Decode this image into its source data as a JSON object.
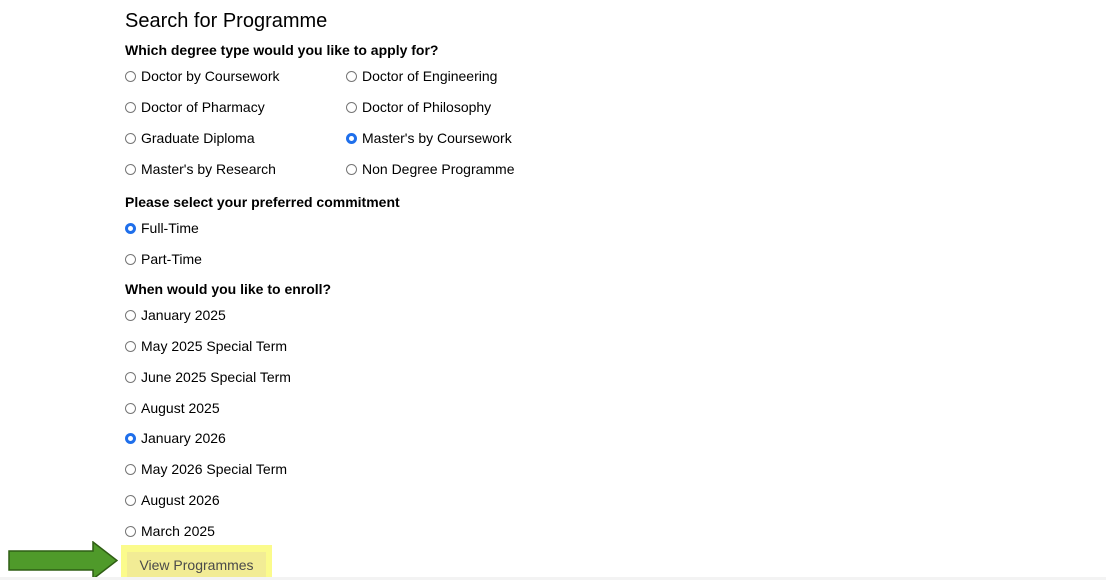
{
  "title": "Search for Programme",
  "degree": {
    "question": "Which degree type would you like to apply for?",
    "options": [
      {
        "label": "Doctor by Coursework",
        "selected": false
      },
      {
        "label": "Doctor of Engineering",
        "selected": false
      },
      {
        "label": "Doctor of Pharmacy",
        "selected": false
      },
      {
        "label": "Doctor of Philosophy",
        "selected": false
      },
      {
        "label": "Graduate Diploma",
        "selected": false
      },
      {
        "label": "Master's by Coursework",
        "selected": true
      },
      {
        "label": "Master's by Research",
        "selected": false
      },
      {
        "label": "Non Degree Programme",
        "selected": false
      }
    ]
  },
  "commitment": {
    "question": "Please select your preferred commitment",
    "options": [
      {
        "label": "Full-Time",
        "selected": true
      },
      {
        "label": "Part-Time",
        "selected": false
      }
    ]
  },
  "enroll": {
    "question": "When would you like to enroll?",
    "options": [
      {
        "label": "January 2025",
        "selected": false
      },
      {
        "label": "May 2025 Special Term",
        "selected": false
      },
      {
        "label": "June 2025 Special Term",
        "selected": false
      },
      {
        "label": "August 2025",
        "selected": false
      },
      {
        "label": "January 2026",
        "selected": true
      },
      {
        "label": "May 2026 Special Term",
        "selected": false
      },
      {
        "label": "August 2026",
        "selected": false
      },
      {
        "label": "March 2025",
        "selected": false
      }
    ]
  },
  "button": {
    "label": "View Programmes"
  },
  "colors": {
    "radio_checked": "#1f6feb",
    "button_highlight": "#fbfb8c",
    "arrow": "#4f9a2a"
  }
}
